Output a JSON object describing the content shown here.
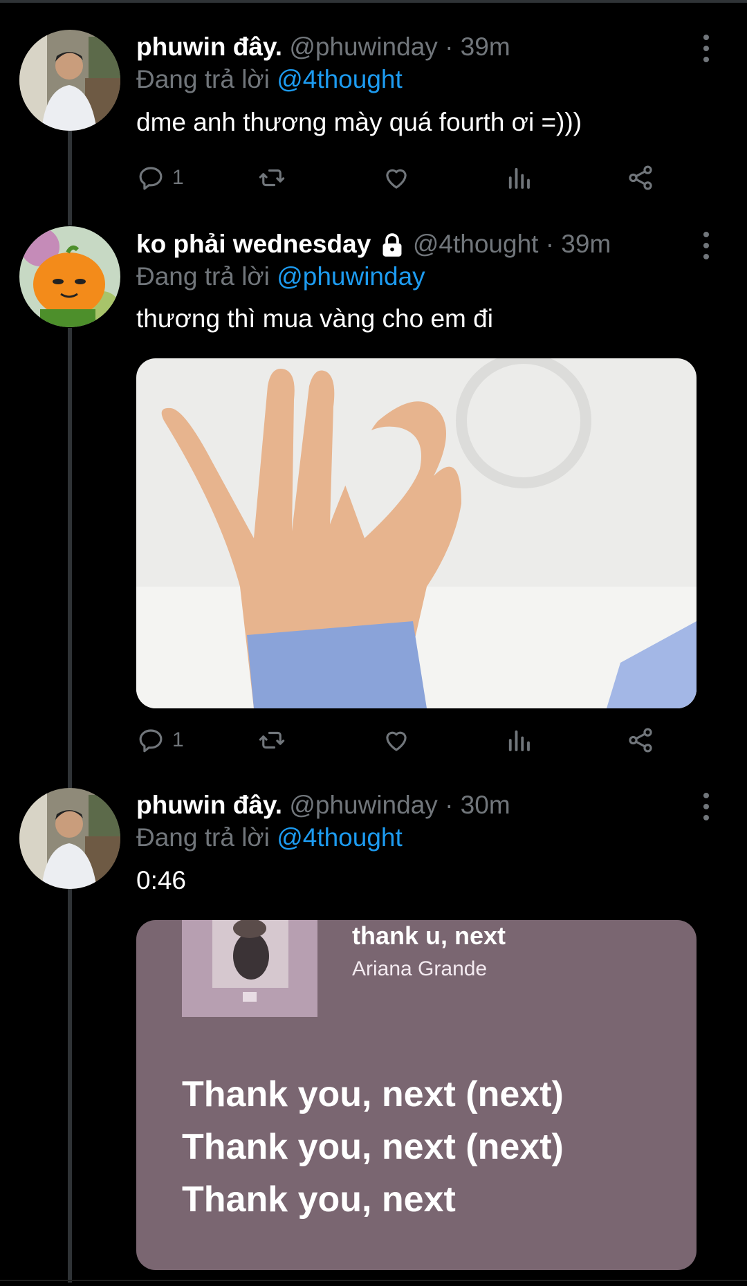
{
  "tweets": [
    {
      "name": "phuwin đây.",
      "meta": "@phuwinday · 39m",
      "replying_prefix": "Đang trả lời",
      "replying_to": "@4thought",
      "text": "dme anh thương mày quá fourth ơi =)))",
      "reply_count": "1"
    },
    {
      "name": "ko phải wednesday",
      "protected_icon": "lock-icon",
      "meta": "@4thought · 39m",
      "replying_prefix": "Đang trả lời",
      "replying_to": "@phuwinday",
      "text": "thương thì mua vàng cho em đi",
      "reply_count": "1",
      "media": "photo of hand making heart shape with fingers"
    },
    {
      "name": "phuwin đây.",
      "meta": "@phuwinday · 30m",
      "replying_prefix": "Đang trả lời",
      "replying_to": "@4thought",
      "text": "0:46",
      "music_card": {
        "song": "thank u, next",
        "artist": "Ariana Grande",
        "lyrics": [
          "Thank you, next (next)",
          "Thank you, next (next)",
          "Thank you, next"
        ],
        "background_color": "#7a6671"
      }
    }
  ],
  "colors": {
    "background": "#000000",
    "secondary_text": "#71767b",
    "link": "#1d9bf0",
    "divider": "#2f3336"
  }
}
